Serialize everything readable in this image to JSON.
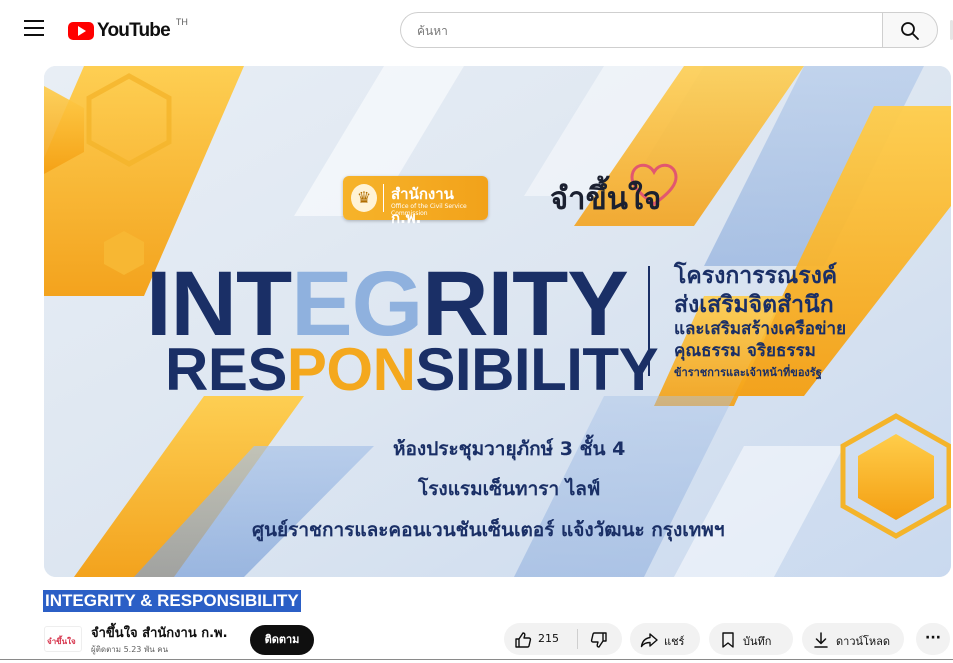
{
  "header": {
    "logo_text": "YouTube",
    "region": "TH",
    "search_placeholder": "ค้นหา"
  },
  "thumbnail": {
    "org_badge_title": "สำนักงาน ก.พ.",
    "org_badge_sub": "Office of the Civil Service Commission",
    "brand": "จำขึ้นใจ",
    "headline_1_parts": [
      "INT",
      "EG",
      "RITY"
    ],
    "headline_2_parts": [
      "RES",
      "PON",
      "SIBILITY"
    ],
    "project_lines": [
      "โครงการรณรงค์",
      "ส่งเสริมจิตสำนึก",
      "และเสริมสร้างเครือข่าย",
      "คุณธรรม จริยธรรม",
      "ข้าราชการและเจ้าหน้าที่ของรัฐ"
    ],
    "venue_lines": [
      "ห้องประชุมวายุภักษ์ 3 ชั้น 4",
      "โรงแรมเซ็นทารา ไลฟ์",
      "ศูนย์ราชการและคอนเวนชันเซ็นเตอร์ แจ้งวัฒนะ กรุงเทพฯ"
    ],
    "colors": {
      "navy": "#1a2f66",
      "gold": "#f4a81e",
      "light_blue": "#8fb1de"
    }
  },
  "video": {
    "title": "INTEGRITY & RESPONSIBILITY",
    "channel_name": "จำขึ้นใจ สำนักงาน ก.พ.",
    "channel_avatar_text": "จำขึ้นใจ",
    "subscribers": "ผู้ติดตาม 5.23 พัน คน",
    "subscribe_label": "ติดตาม"
  },
  "actions": {
    "like_count": "215",
    "share_label": "แชร์",
    "save_label": "บันทึก",
    "download_label": "ดาวน์โหลด",
    "more_label": "···"
  }
}
